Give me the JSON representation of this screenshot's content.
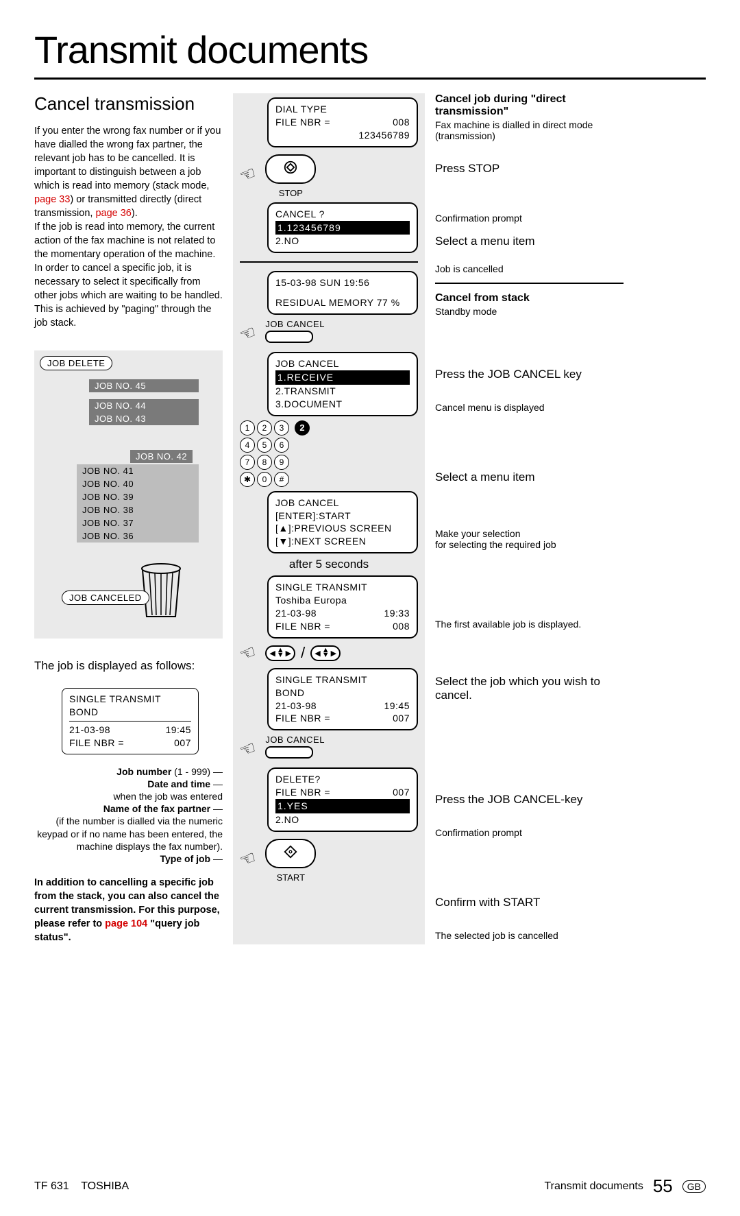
{
  "title": "Transmit documents",
  "left": {
    "heading": "Cancel transmission",
    "para1a": "If you enter the wrong fax number or if you have dialled the wrong fax partner, the relevant job has to be cancelled. It is important to distinguish between a job which is read into memory (stack mode, ",
    "ref1": "page 33",
    "para1b": ") or transmitted directly (direct transmission, ",
    "ref2": "page 36",
    "para1c": ").",
    "para2": "If the job is read into memory, the current action of the fax machine is not related to the momentary operation of the machine. In order to cancel a specific job, it is necessary to select it specifically from other jobs which are waiting to be handled. This is achieved by \"paging\" through the job stack.",
    "job_delete": "JOB DELETE",
    "jobs_top": [
      "JOB NO. 45",
      "JOB NO. 44",
      "JOB NO. 43"
    ],
    "job_inset": "JOB NO. 42",
    "jobs_bottom": [
      "JOB NO. 41",
      "JOB NO. 40",
      "JOB NO. 39",
      "JOB NO. 38",
      "JOB NO. 37",
      "JOB NO. 36"
    ],
    "job_canceled": "JOB CANCELED",
    "display_label": "The job is displayed as follows:",
    "jobbox_l1": "SINGLE TRANSMIT",
    "jobbox_l2": "BOND",
    "jobbox_date": "21-03-98",
    "jobbox_time": "19:45",
    "jobbox_file_l": "FILE NBR =",
    "jobbox_file_v": "007",
    "annot1_b": "Job number",
    "annot1_r": " (1 - 999)",
    "annot2_b": "Date and time",
    "annot2_t": "when the job was entered",
    "annot3_b": "Name of the fax partner",
    "annot3_t": "(if the number is dialled via the numeric keypad or if no name has been entered, the machine displays the fax number).",
    "annot4_b": "Type of job",
    "addn_a": "In addition to cancelling a specific job from the stack, you can also cancel the current transmission. For this purpose, please refer to ",
    "addn_ref": "page 104",
    "addn_b": " \"query job status\"."
  },
  "mid": {
    "lcd1_l1": "DIAL TYPE",
    "lcd1_l2l": "FILE NBR =",
    "lcd1_l2r": "008",
    "lcd1_l3": "123456789",
    "stop": "STOP",
    "lcd2_l1": "CANCEL ?",
    "lcd2_l2": "1.123456789",
    "lcd2_l3": "2.NO",
    "lcd3_l1": "15-03-98   SUN   19:56",
    "lcd3_l2": "RESIDUAL MEMORY 77 %",
    "jobcancel_key": "JOB CANCEL",
    "lcd4_l1": "JOB CANCEL",
    "lcd4_l2": "1.RECEIVE",
    "lcd4_l3": "2.TRANSMIT",
    "lcd4_l4": "3.DOCUMENT",
    "keypad": [
      "1",
      "2",
      "3",
      "4",
      "5",
      "6",
      "7",
      "8",
      "9",
      "✱",
      "0",
      "#"
    ],
    "keypad_sel": "2",
    "lcd5_l1": "JOB CANCEL",
    "lcd5_l2": "[ENTER]:START",
    "lcd5_l3": "[▲]:PREVIOUS SCREEN",
    "lcd5_l4": "[▼]:NEXT SCREEN",
    "after5": "after 5 seconds",
    "lcd6_l1": "SINGLE TRANSMIT",
    "lcd6_l2": "Toshiba Europa",
    "lcd6_d": "21-03-98",
    "lcd6_t": "19:33",
    "lcd6_fl": "FILE NBR =",
    "lcd6_fv": "008",
    "slash": "/",
    "lcd7_l1": "SINGLE TRANSMIT",
    "lcd7_l2": "BOND",
    "lcd7_d": "21-03-98",
    "lcd7_t": "19:45",
    "lcd7_fl": "FILE NBR =",
    "lcd7_fv": "007",
    "lcd8_l1": "DELETE?",
    "lcd8_l2l": "FILE NBR =",
    "lcd8_l2r": "007",
    "lcd8_l3": "1.YES",
    "lcd8_l4": "2.NO",
    "start": "START"
  },
  "right": {
    "h1": "Cancel job during \"direct transmission\"",
    "t1": "Fax machine is dialled in direct mode (transmission)",
    "i1": "Press STOP",
    "n1": "Confirmation prompt",
    "i2": "Select a menu item",
    "n2": "Job is cancelled",
    "h2": "Cancel from stack",
    "t2": "Standby mode",
    "i3": "Press the JOB CANCEL key",
    "n3": "Cancel menu is displayed",
    "i4": "Select a menu item",
    "n4a": "Make your selection",
    "n4b": "for selecting the required job",
    "n5": "The first available job is displayed.",
    "i5": "Select the job which you wish to cancel.",
    "i6": "Press the JOB CANCEL-key",
    "n6": "Confirmation prompt",
    "i7": "Confirm with START",
    "n7": "The selected job is cancelled"
  },
  "footer": {
    "model": "TF 631",
    "brand": "TOSHIBA",
    "section": "Transmit documents",
    "page": "55",
    "lang": "GB"
  }
}
